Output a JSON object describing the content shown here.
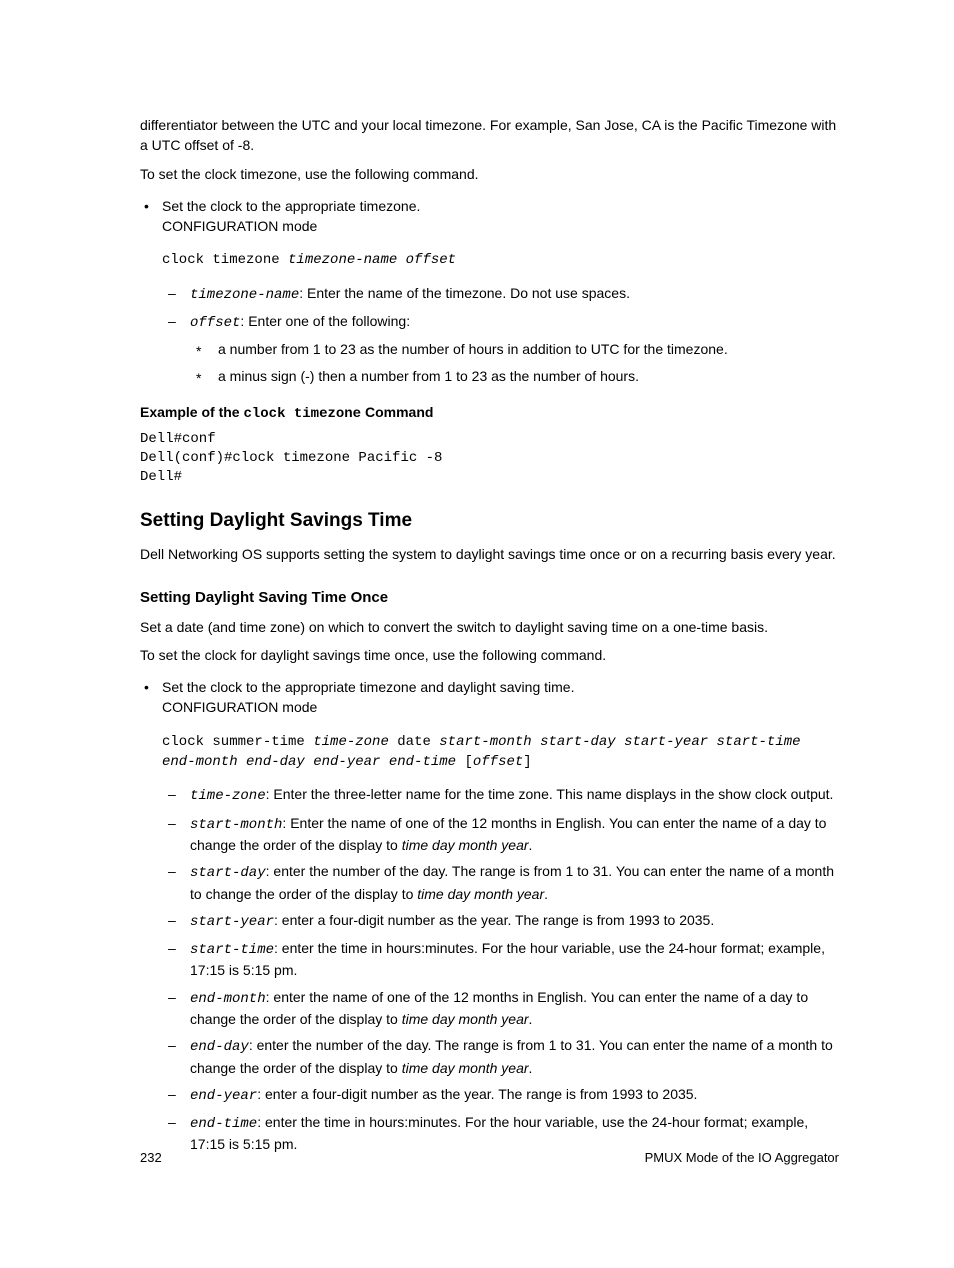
{
  "intro": {
    "p1": "differentiator between the UTC and your local timezone. For example, San Jose, CA is the Pacific Timezone with a UTC offset of -8.",
    "p2": "To set the clock timezone, use the following command."
  },
  "tz_bullet": {
    "line1": "Set the clock to the appropriate timezone.",
    "line2": "CONFIGURATION mode",
    "cmd_prefix": "clock timezone ",
    "cmd_args": "timezone-name offset",
    "param1_name": "timezone-name",
    "param1_desc": ": Enter the name of the timezone. Do not use spaces.",
    "param2_name": "offset",
    "param2_desc": ": Enter one of the following:",
    "star1": "a number from 1 to 23 as the number of hours in addition to UTC for the timezone.",
    "star2": "a minus sign (-) then a number from 1 to 23 as the number of hours."
  },
  "example": {
    "heading_prefix": "Example of the ",
    "heading_cmd": "clock timezone",
    "heading_suffix": " Command",
    "code": "Dell#conf\nDell(conf)#clock timezone Pacific -8\nDell#"
  },
  "dst": {
    "heading": "Setting Daylight Savings Time",
    "p1": "Dell Networking OS supports setting the system to daylight savings time once or on a recurring basis every year.",
    "sub_heading": "Setting Daylight Saving Time Once",
    "p2": "Set a date (and time zone) on which to convert the switch to daylight saving time on a one-time basis.",
    "p3": "To set the clock for daylight savings time once, use the following command.",
    "bullet_line1": "Set the clock to the appropriate timezone and daylight saving time.",
    "bullet_line2": "CONFIGURATION mode",
    "cmd_l1_a": "clock summer-time ",
    "cmd_l1_b": "time-zone",
    "cmd_l1_c": " date ",
    "cmd_l1_d": "start-month start-day start-year start-time",
    "cmd_l2_a": "end-month end-day end-year end-time",
    "cmd_l2_b": " [",
    "cmd_l2_c": "offset",
    "cmd_l2_d": "]",
    "params": [
      {
        "n": "time-zone",
        "d": ": Enter the three-letter name for the time zone. This name displays in the show clock output."
      },
      {
        "n": "start-month",
        "d_a": ": Enter the name of one of the 12 months in English. You can enter the name of a day to change the order of the display to ",
        "d_b": "time day month year",
        "d_c": "."
      },
      {
        "n": "start-day",
        "d_a": ": enter the number of the day. The range is from 1 to 31. You can enter the name of a month to change the order of the display to ",
        "d_b": "time day month year",
        "d_c": "."
      },
      {
        "n": "start-year",
        "d": ": enter a four-digit number as the year. The range is from 1993 to 2035."
      },
      {
        "n": "start-time",
        "d": ": enter the time in hours:minutes. For the hour variable, use the 24-hour format; example, 17:15 is 5:15 pm."
      },
      {
        "n": "end-month",
        "d_a": ": enter the name of one of the 12 months in English. You can enter the name of a day to change the order of the display to ",
        "d_b": "time day month year",
        "d_c": "."
      },
      {
        "n": "end-day",
        "d_a": ": enter the number of the day. The range is from 1 to 31. You can enter the name of a month to change the order of the display to ",
        "d_b": "time day month year",
        "d_c": "."
      },
      {
        "n": "end-year",
        "d": ": enter a four-digit number as the year. The range is from 1993 to 2035."
      },
      {
        "n": "end-time",
        "d": ": enter the time in hours:minutes. For the hour variable, use the 24-hour format; example, 17:15 is 5:15 pm."
      }
    ]
  },
  "footer": {
    "page": "232",
    "title": "PMUX Mode of the IO Aggregator"
  }
}
